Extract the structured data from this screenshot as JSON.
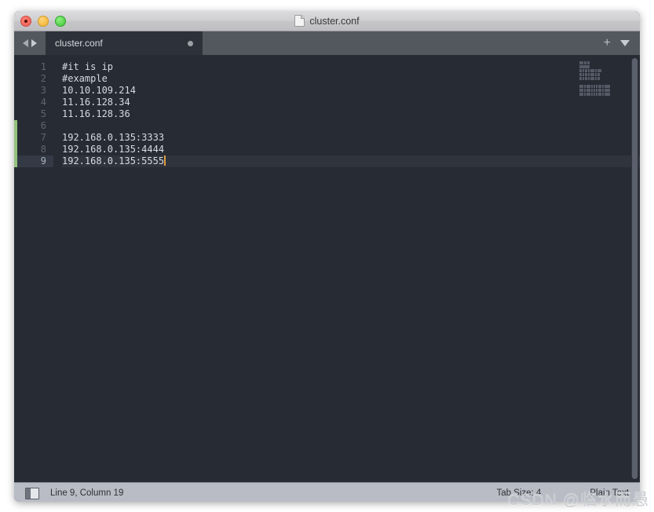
{
  "window": {
    "title": "cluster.conf",
    "traffic_lights": [
      "close",
      "minimize",
      "maximize"
    ]
  },
  "tab_bar": {
    "tabs": [
      {
        "label": "cluster.conf",
        "dirty": true,
        "active": true
      }
    ],
    "new_tab_label": "+",
    "menu_label": "▼"
  },
  "editor": {
    "lines": [
      {
        "number": "1",
        "text": "#it is ip"
      },
      {
        "number": "2",
        "text": "#example"
      },
      {
        "number": "3",
        "text": "10.10.109.214"
      },
      {
        "number": "4",
        "text": "11.16.128.34"
      },
      {
        "number": "5",
        "text": "11.16.128.36"
      },
      {
        "number": "6",
        "text": ""
      },
      {
        "number": "7",
        "text": "192.168.0.135:3333"
      },
      {
        "number": "8",
        "text": "192.168.0.135:4444"
      },
      {
        "number": "9",
        "text": "192.168.0.135:5555"
      }
    ],
    "active_line": 9,
    "change_marker_lines": [
      6,
      7,
      8,
      9
    ],
    "colors": {
      "background": "#272b33",
      "text": "#d6dbe3",
      "line_number": "#5f6672",
      "active_line_number": "#aab1bc",
      "cursor": "#e09b43",
      "change_marker": "#93c27e",
      "minimap_block": "#545b67"
    }
  },
  "status_bar": {
    "position": "Line 9, Column 19",
    "tab_size": "Tab Size: 4",
    "syntax": "Plain Text"
  },
  "watermark": {
    "text": "CSDN @临水而愚"
  }
}
